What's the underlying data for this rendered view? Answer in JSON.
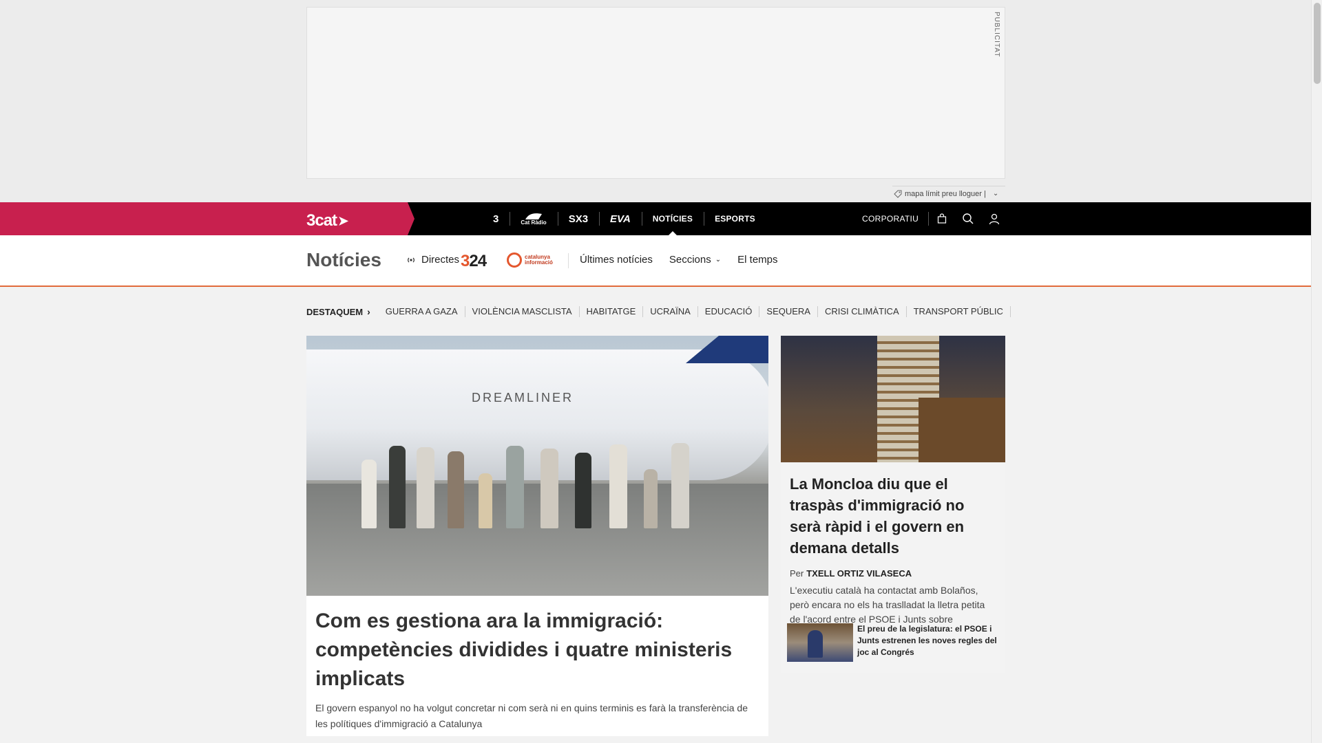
{
  "ad": {
    "label": "PUBLICITAT",
    "tagline": "mapa límit preu lloguer |"
  },
  "topbar": {
    "brand": "3cat",
    "channels": [
      {
        "label": "3",
        "icon": "tv3-logo-icon"
      },
      {
        "label": "Cat Ràdio",
        "icon": "catradio-logo-icon"
      },
      {
        "label": "SX3",
        "icon": "sx3-logo-icon"
      },
      {
        "label": "EVA",
        "icon": "eva-logo-icon"
      },
      {
        "label": "NOTÍCIES",
        "active": true
      },
      {
        "label": "ESPORTS"
      }
    ],
    "corporate": "CORPORATIU",
    "icons": [
      "shop-bag-icon",
      "search-icon",
      "user-icon"
    ]
  },
  "section_nav": {
    "title": "Notícies",
    "live": "Directes",
    "logo_324": {
      "first": "3",
      "rest": "24"
    },
    "logo_ci": "catalunya informació",
    "links": [
      "Últimes notícies",
      "Seccions",
      "El temps"
    ]
  },
  "highlights": {
    "lead": "DESTAQUEM",
    "items": [
      "GUERRA A GAZA",
      "VIOLÈNCIA MASCLISTA",
      "HABITATGE",
      "UCRAÏNA",
      "EDUCACIÓ",
      "SEQUERA",
      "CRISI CLIMÀTICA",
      "TRANSPORT PÚBLIC"
    ]
  },
  "main_article": {
    "image_text": "DREAMLINER",
    "headline": "Com es gestiona ara la immigració: competències dividides i quatre ministeris implicats",
    "summary": "El govern espanyol no ha volgut concretar ni com serà ni en quins terminis es farà la transferència de les polítiques d'immigració a Catalunya"
  },
  "side_article": {
    "headline": "La Moncloa diu que el traspàs d'immigració no serà ràpid i el govern en demana detalls",
    "byline_prefix": "Per",
    "author": "TXELL ORTIZ VILASECA",
    "summary": "L'executiu català ha contactat amb Bolaños, però encara no els ha traslladat la lletra petita de l'acord entre el PSOE i Junts sobre immigració",
    "related": {
      "title": "El preu de la legislatura: el PSOE i Junts estrenen les noves regles del joc al Congrés"
    }
  }
}
